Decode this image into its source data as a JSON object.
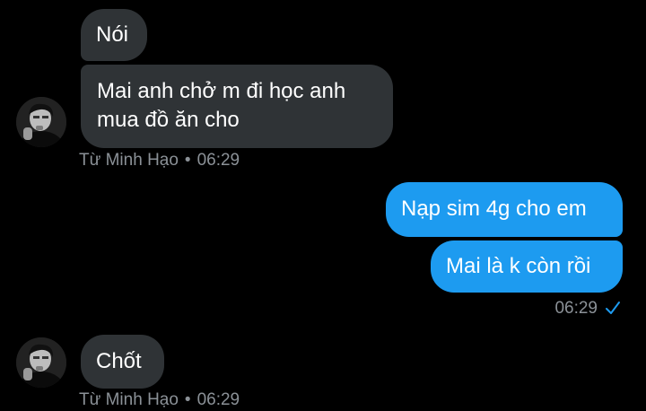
{
  "conversation": {
    "messages": [
      {
        "from": "Từ Minh Hạo",
        "text": "Nói"
      },
      {
        "from": "Từ Minh Hạo",
        "text_line1": "Mai anh chở m đi học anh",
        "text_line2": "mua đồ ăn cho"
      },
      {
        "from": "me",
        "text": "Nạp sim 4g cho em"
      },
      {
        "from": "me",
        "text": "Mai là k còn rồi"
      },
      {
        "from": "Từ Minh Hạo",
        "text": "Chốt"
      }
    ],
    "group1_meta": {
      "sender": "Từ Minh Hạo",
      "time": "06:29"
    },
    "sent_meta": {
      "time": "06:29"
    },
    "group2_meta": {
      "sender": "Từ Minh Hạo",
      "time": "06:29"
    }
  },
  "colors": {
    "background": "#000000",
    "incoming_bubble": "#2f3336",
    "outgoing_bubble": "#1d9bf0",
    "meta_text": "#8b9197",
    "read_check": "#1d9bf0"
  },
  "icons": {
    "avatar": "contact-avatar",
    "read_status": "checkmark-icon"
  }
}
